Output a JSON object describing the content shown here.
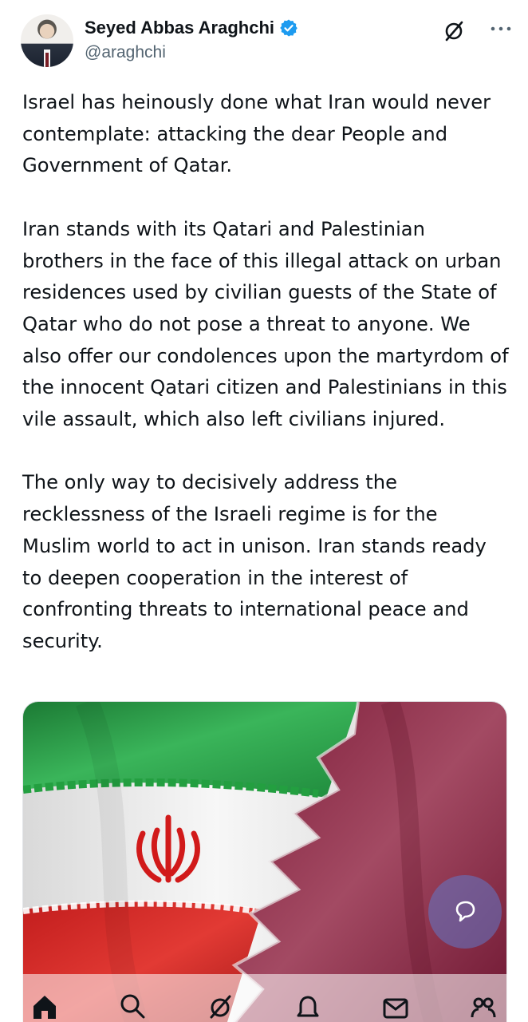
{
  "author": {
    "display_name": "Seyed Abbas Araghchi",
    "handle": "@araghchi",
    "verified": true
  },
  "header_actions": {
    "grok_icon": "grok-slash-icon",
    "more_icon": "more-horizontal-icon"
  },
  "tweet": {
    "paragraphs": [
      "Israel has heinously done what Iran would never contemplate: attacking the dear People and Government of Qatar.",
      "Iran stands with its Qatari and Palestinian brothers in the face of this illegal attack on urban residences used by civilian guests of the State of Qatar who do not pose a threat to anyone. We also offer our condolences upon the martyrdom of the innocent Qatari citizen and Palestinians in this vile assault, which also left civilians injured.",
      "The only way to decisively address the recklessness of the Israeli regime is for the Muslim world to act in unison. Iran stands ready to deepen cooperation in the interest of confronting threats to international peace and security."
    ]
  },
  "media": {
    "subject": "iran-flag-and-qatar-flag",
    "colors": {
      "iran_green": "#239f40",
      "iran_white": "#f2f2f2",
      "iran_red": "#da0000",
      "qatar_maroon": "#8a1538"
    }
  },
  "fab": {
    "icon": "reply-bubble-icon"
  },
  "bottom_nav": [
    {
      "icon": "home-icon",
      "active": true
    },
    {
      "icon": "search-icon"
    },
    {
      "icon": "grok-icon"
    },
    {
      "icon": "notifications-icon"
    },
    {
      "icon": "messages-icon"
    },
    {
      "icon": "communities-icon"
    }
  ],
  "accent_color": "#1d9bf0"
}
